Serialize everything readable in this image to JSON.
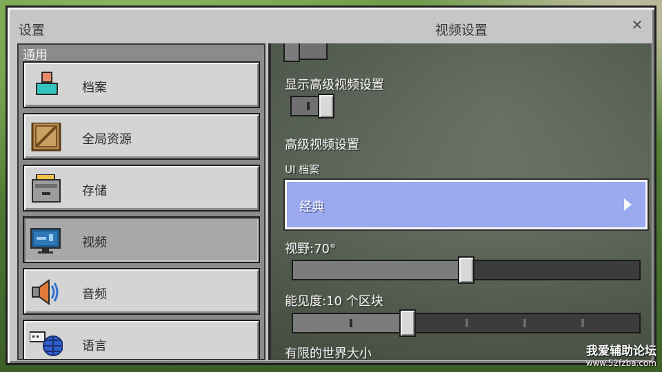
{
  "window": {
    "title_left": "设置",
    "title_center": "视频设置",
    "close_glyph": "✕"
  },
  "sidebar": {
    "header": "通用",
    "items": [
      {
        "label": "档案",
        "icon": "profile-icon"
      },
      {
        "label": "全局资源",
        "icon": "crate-icon"
      },
      {
        "label": "存储",
        "icon": "storage-drawer-icon"
      },
      {
        "label": "视频",
        "icon": "monitor-icon",
        "active": true
      },
      {
        "label": "音频",
        "icon": "speaker-icon"
      },
      {
        "label": "语言",
        "icon": "language-globe-icon"
      }
    ]
  },
  "panel": {
    "show_advanced_label": "显示高级视频设置",
    "show_advanced_on": true,
    "advanced_heading": "高级视频设置",
    "ui_profile_label": "UI 档案",
    "ui_profile_value": "经典",
    "fov_label": "视野:70°",
    "fov_value": 70,
    "fov_fraction": 0.5,
    "render_distance_label": "能见度:10 个区块",
    "render_distance_value": 10,
    "render_distance_fraction": 0.33,
    "world_size_label": "有限的世界大小"
  },
  "watermark": {
    "line1": "我爱辅助论坛",
    "line2": "www.52fzba.com"
  },
  "colors": {
    "window_bg": "#c6c6c6",
    "dropdown_bg": "#9ba9ef",
    "slider_track": "#3c3c3c",
    "slider_fill": "#7c7c7c"
  }
}
